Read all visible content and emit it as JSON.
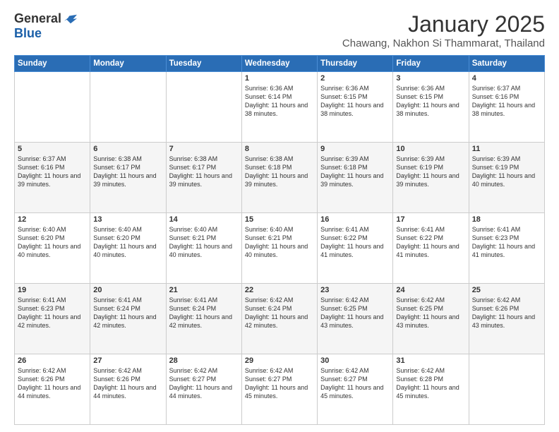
{
  "logo": {
    "general": "General",
    "blue": "Blue"
  },
  "header": {
    "month_year": "January 2025",
    "subtitle": "Chawang, Nakhon Si Thammarat, Thailand"
  },
  "days_header": [
    "Sunday",
    "Monday",
    "Tuesday",
    "Wednesday",
    "Thursday",
    "Friday",
    "Saturday"
  ],
  "weeks": [
    [
      {
        "day": "",
        "content": ""
      },
      {
        "day": "",
        "content": ""
      },
      {
        "day": "",
        "content": ""
      },
      {
        "day": "1",
        "content": "Sunrise: 6:36 AM\nSunset: 6:14 PM\nDaylight: 11 hours and 38 minutes."
      },
      {
        "day": "2",
        "content": "Sunrise: 6:36 AM\nSunset: 6:15 PM\nDaylight: 11 hours and 38 minutes."
      },
      {
        "day": "3",
        "content": "Sunrise: 6:36 AM\nSunset: 6:15 PM\nDaylight: 11 hours and 38 minutes."
      },
      {
        "day": "4",
        "content": "Sunrise: 6:37 AM\nSunset: 6:16 PM\nDaylight: 11 hours and 38 minutes."
      }
    ],
    [
      {
        "day": "5",
        "content": "Sunrise: 6:37 AM\nSunset: 6:16 PM\nDaylight: 11 hours and 39 minutes."
      },
      {
        "day": "6",
        "content": "Sunrise: 6:38 AM\nSunset: 6:17 PM\nDaylight: 11 hours and 39 minutes."
      },
      {
        "day": "7",
        "content": "Sunrise: 6:38 AM\nSunset: 6:17 PM\nDaylight: 11 hours and 39 minutes."
      },
      {
        "day": "8",
        "content": "Sunrise: 6:38 AM\nSunset: 6:18 PM\nDaylight: 11 hours and 39 minutes."
      },
      {
        "day": "9",
        "content": "Sunrise: 6:39 AM\nSunset: 6:18 PM\nDaylight: 11 hours and 39 minutes."
      },
      {
        "day": "10",
        "content": "Sunrise: 6:39 AM\nSunset: 6:19 PM\nDaylight: 11 hours and 39 minutes."
      },
      {
        "day": "11",
        "content": "Sunrise: 6:39 AM\nSunset: 6:19 PM\nDaylight: 11 hours and 40 minutes."
      }
    ],
    [
      {
        "day": "12",
        "content": "Sunrise: 6:40 AM\nSunset: 6:20 PM\nDaylight: 11 hours and 40 minutes."
      },
      {
        "day": "13",
        "content": "Sunrise: 6:40 AM\nSunset: 6:20 PM\nDaylight: 11 hours and 40 minutes."
      },
      {
        "day": "14",
        "content": "Sunrise: 6:40 AM\nSunset: 6:21 PM\nDaylight: 11 hours and 40 minutes."
      },
      {
        "day": "15",
        "content": "Sunrise: 6:40 AM\nSunset: 6:21 PM\nDaylight: 11 hours and 40 minutes."
      },
      {
        "day": "16",
        "content": "Sunrise: 6:41 AM\nSunset: 6:22 PM\nDaylight: 11 hours and 41 minutes."
      },
      {
        "day": "17",
        "content": "Sunrise: 6:41 AM\nSunset: 6:22 PM\nDaylight: 11 hours and 41 minutes."
      },
      {
        "day": "18",
        "content": "Sunrise: 6:41 AM\nSunset: 6:23 PM\nDaylight: 11 hours and 41 minutes."
      }
    ],
    [
      {
        "day": "19",
        "content": "Sunrise: 6:41 AM\nSunset: 6:23 PM\nDaylight: 11 hours and 42 minutes."
      },
      {
        "day": "20",
        "content": "Sunrise: 6:41 AM\nSunset: 6:24 PM\nDaylight: 11 hours and 42 minutes."
      },
      {
        "day": "21",
        "content": "Sunrise: 6:41 AM\nSunset: 6:24 PM\nDaylight: 11 hours and 42 minutes."
      },
      {
        "day": "22",
        "content": "Sunrise: 6:42 AM\nSunset: 6:24 PM\nDaylight: 11 hours and 42 minutes."
      },
      {
        "day": "23",
        "content": "Sunrise: 6:42 AM\nSunset: 6:25 PM\nDaylight: 11 hours and 43 minutes."
      },
      {
        "day": "24",
        "content": "Sunrise: 6:42 AM\nSunset: 6:25 PM\nDaylight: 11 hours and 43 minutes."
      },
      {
        "day": "25",
        "content": "Sunrise: 6:42 AM\nSunset: 6:26 PM\nDaylight: 11 hours and 43 minutes."
      }
    ],
    [
      {
        "day": "26",
        "content": "Sunrise: 6:42 AM\nSunset: 6:26 PM\nDaylight: 11 hours and 44 minutes."
      },
      {
        "day": "27",
        "content": "Sunrise: 6:42 AM\nSunset: 6:26 PM\nDaylight: 11 hours and 44 minutes."
      },
      {
        "day": "28",
        "content": "Sunrise: 6:42 AM\nSunset: 6:27 PM\nDaylight: 11 hours and 44 minutes."
      },
      {
        "day": "29",
        "content": "Sunrise: 6:42 AM\nSunset: 6:27 PM\nDaylight: 11 hours and 45 minutes."
      },
      {
        "day": "30",
        "content": "Sunrise: 6:42 AM\nSunset: 6:27 PM\nDaylight: 11 hours and 45 minutes."
      },
      {
        "day": "31",
        "content": "Sunrise: 6:42 AM\nSunset: 6:28 PM\nDaylight: 11 hours and 45 minutes."
      },
      {
        "day": "",
        "content": ""
      }
    ]
  ]
}
